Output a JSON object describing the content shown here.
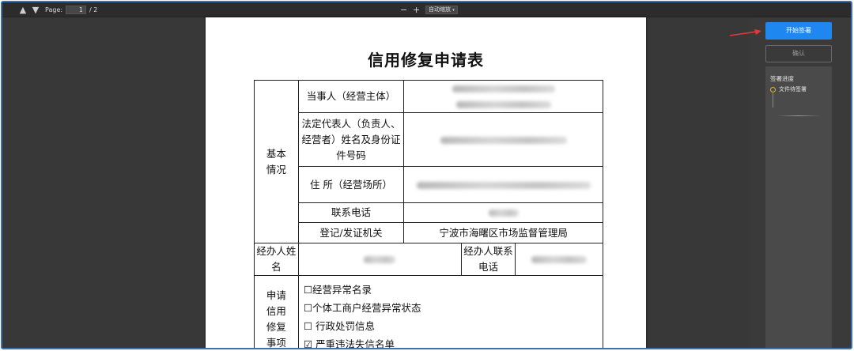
{
  "toolbar": {
    "page_label": "Page:",
    "page_current": "1",
    "page_total": "/ 2",
    "zoom_out": "−",
    "zoom_in": "+",
    "zoom_select": "自动缩放"
  },
  "document": {
    "title": "信用修复申请表",
    "rows": {
      "basic_info": "基本情况",
      "party": "当事人（经营主体）",
      "legal_rep": "法定代表人（负责人、经营者）姓名及身份证件号码",
      "address": "住 所（经营场所）",
      "phone": "联系电话",
      "registrar": "登记/发证机关",
      "registrar_value": "宁波市海曙区市场监督管理局",
      "agent_name": "经办人姓名",
      "agent_phone": "经办人联系电话",
      "apply_items": "申请信用修复事项"
    },
    "check_items": [
      "☐经营异常名录",
      "☐个体工商户经营异常状态",
      "☐ 行政处罚信息",
      "☑ 严重违法失信名单"
    ]
  },
  "side_panel": {
    "start_sign": "开始签署",
    "confirm": "确认",
    "progress_title": "签署进度",
    "progress_step": "文件待签署"
  },
  "colors": {
    "accent": "#1e88f0",
    "arrow": "#e53935",
    "step_marker": "#e2b13c"
  }
}
